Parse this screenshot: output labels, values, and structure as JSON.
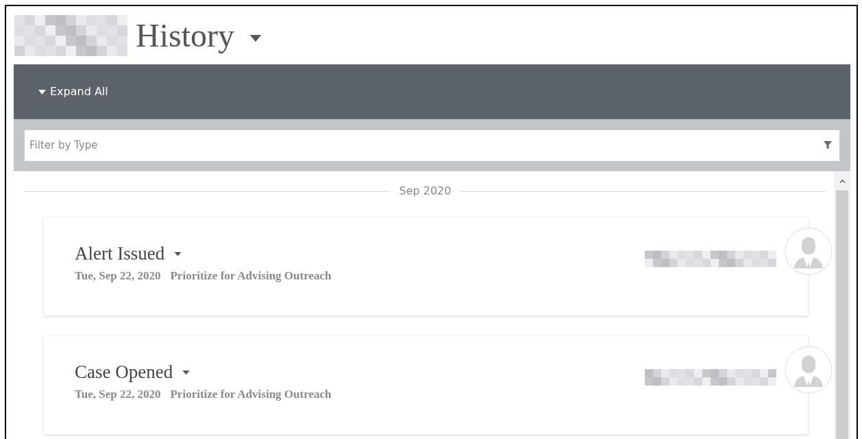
{
  "header": {
    "title": "History"
  },
  "toolbar": {
    "expand_all": "Expand All"
  },
  "filter": {
    "placeholder": "Filter by Type"
  },
  "timeline": {
    "month": "Sep 2020",
    "events": [
      {
        "title": "Alert Issued",
        "date": "Tue, Sep 22, 2020",
        "category": "Prioritize for Advising Outreach"
      },
      {
        "title": "Case Opened",
        "date": "Tue, Sep 22, 2020",
        "category": "Prioritize for Advising Outreach"
      }
    ]
  }
}
